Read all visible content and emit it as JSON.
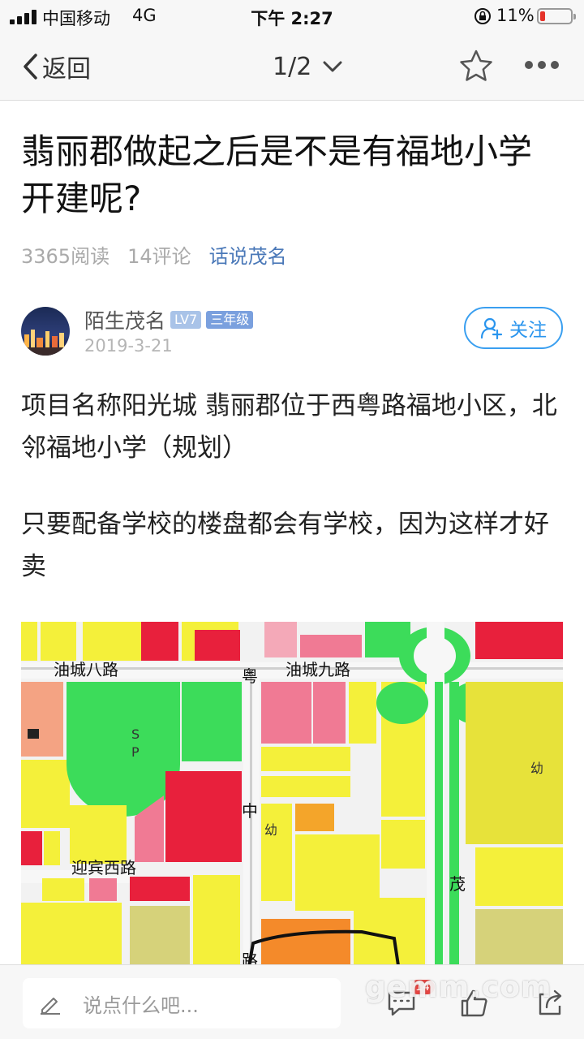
{
  "status_bar": {
    "carrier": "中国移动",
    "network": "4G",
    "time": "下午 2:27",
    "battery_percent": "11%",
    "battery_level": 0.11
  },
  "nav": {
    "back_label": "返回",
    "pager": "1/2"
  },
  "article": {
    "title": "翡丽郡做起之后是不是有福地小学开建呢?",
    "reads": "3365阅读",
    "comments": "14评论",
    "forum": "话说茂名",
    "author": {
      "name": "陌生茂名",
      "level": "LV7",
      "grade": "三年级",
      "date": "2019-3-21",
      "follow_label": "关注"
    },
    "paragraphs": [
      "项目名称阳光城 翡丽郡位于西粤路福地小区，北邻福地小学（规划）",
      "只要配备学校的楼盘都会有学校，因为这样才好卖"
    ]
  },
  "map": {
    "labels": {
      "road1": "油城八路",
      "road2": "油城九路",
      "road3": "迎宾西路",
      "yue": "粤",
      "zhong": "中",
      "mao": "茂",
      "lu": "路",
      "sp": "S",
      "sp2": "P",
      "you1": "幼",
      "you2": "幼"
    }
  },
  "bottom": {
    "comment_placeholder": "说点什么吧...",
    "comment_count_badge": "14",
    "watermark": "gemm.com"
  },
  "colors": {
    "accent_blue": "#2a95ee",
    "forum_blue": "#4a78b8",
    "battery_red": "#e5332a",
    "badge_red": "#e64340"
  }
}
